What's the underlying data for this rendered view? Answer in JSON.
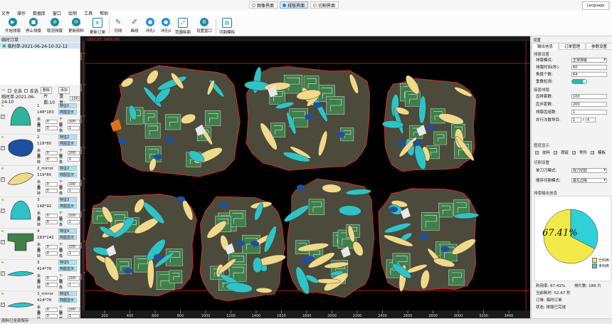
{
  "view_tabs": [
    {
      "label": "图像界面",
      "active": false
    },
    {
      "label": "排版界面",
      "active": true
    },
    {
      "label": "切割界面",
      "active": false
    }
  ],
  "language_label": "Language",
  "menu": [
    "文件",
    "操作",
    "数据库",
    "窗口",
    "绘制",
    "工具",
    "帮助"
  ],
  "toolbar": [
    {
      "label": "开始排版",
      "icon": "play-icon"
    },
    {
      "label": "停止排版",
      "icon": "stop-icon"
    },
    {
      "label": "取消排版",
      "icon": "cancel-icon"
    },
    {
      "label": "更新原料",
      "icon": "refresh-icon"
    },
    {
      "label": "更新订单",
      "icon": "document-icon"
    },
    {
      "label": "切线",
      "icon": "pen-icon"
    },
    {
      "label": "画线",
      "icon": "pencil-icon"
    },
    {
      "label": "冲孔I",
      "icon": "punch-icon"
    },
    {
      "label": "冲孔II",
      "icon": "punch-icon"
    },
    {
      "label": "范围标割",
      "icon": "expand-icon"
    },
    {
      "label": "设置窗口",
      "icon": "gear-icon"
    },
    {
      "label": "切割模拟",
      "icon": "simulate-icon"
    }
  ],
  "left": {
    "header": "临时订单",
    "order_name": "临时单-2021-06-24-10-32-12",
    "select_all": "全选",
    "invert": "反选",
    "delete": "删除",
    "add": "添加",
    "layout_label": "临时单-2021-06-24-10",
    "piece_count_label": "片数:10",
    "repeat_label": "重复:",
    "repeat_value": "100",
    "parts": [
      {
        "name": "1",
        "dim": "148*183",
        "b1": "特征1",
        "b2": "简图显示",
        "qty_label": "余量",
        "qty": "0",
        "cnt_label": "个数",
        "cnt": "100",
        "rot_label": "旋转",
        "rot": "0",
        "mirror_label": "镜像",
        "mirror": "1",
        "shape": "bell",
        "color": "#2fb39a",
        "checked": true
      },
      {
        "name": "2",
        "dim": "119*80",
        "b1": "特征2",
        "b2": "简图显示",
        "qty_label": "余量",
        "qty": "0",
        "cnt_label": "个数",
        "cnt": "100",
        "rot_label": "旋转",
        "rot": "0",
        "mirror_label": "镜像",
        "mirror": "1",
        "shape": "blob",
        "color": "#1f4fa0",
        "checked": true
      },
      {
        "name": "2_mirror",
        "dim": "119*80",
        "b1": "特征2",
        "b2": "简图显示",
        "qty_label": "余量",
        "qty": "0",
        "cnt_label": "个数",
        "cnt": "100",
        "rot_label": "旋转",
        "rot": "0",
        "mirror_label": "镜像",
        "mirror": "1",
        "shape": "leaf",
        "color": "#f0d98a",
        "checked": true
      },
      {
        "name": "3",
        "dim": "148*92",
        "b1": "特征3",
        "b2": "简图显示",
        "qty_label": "余量",
        "qty": "0",
        "cnt_label": "个数",
        "cnt": "100",
        "rot_label": "旋转",
        "rot": "0",
        "mirror_label": "镜像",
        "mirror": "1",
        "shape": "bell",
        "color": "#2fc3c6",
        "checked": true
      },
      {
        "name": "4",
        "dim": "283*142",
        "b1": "特征4",
        "b2": "简图显示",
        "qty_label": "余量",
        "qty": "0",
        "cnt_label": "个数",
        "cnt": "100",
        "rot_label": "旋转",
        "rot": "0",
        "mirror_label": "镜像",
        "mirror": "1",
        "shape": "tee",
        "color": "#3f7f4a",
        "checked": true
      },
      {
        "name": "3",
        "dim": "414*78",
        "b1": "特征5",
        "b2": "简图显示",
        "qty_label": "余量",
        "qty": "0",
        "cnt_label": "个数",
        "cnt": "100",
        "rot_label": "旋转",
        "rot": "0",
        "mirror_label": "镜像",
        "mirror": "1",
        "shape": "sliver",
        "color": "#2fc3c6",
        "checked": true
      },
      {
        "name": "3_mirror",
        "dim": "414*78",
        "b1": "特征5",
        "b2": "简图显示",
        "qty_label": "余量",
        "qty": "0",
        "cnt_label": "个数",
        "cnt": "100",
        "rot_label": "旋转",
        "rot": "0",
        "mirror_label": "镜像",
        "mirror": "1",
        "shape": "sliver",
        "color": "#2fc3c6",
        "checked": true
      }
    ]
  },
  "canvas": {
    "coord_text": "(257.37, 1465.39)",
    "x_ticks": [
      "200",
      "400",
      "600",
      "800",
      "1000",
      "1200",
      "1400",
      "1600",
      "1800",
      "2000",
      "2200",
      "2400",
      "2600",
      "2800",
      "3000",
      "3200",
      "3400"
    ],
    "y_ticks": [
      "1600",
      "1400",
      "1200",
      "1000",
      "800",
      "600",
      "400",
      "200"
    ]
  },
  "right": {
    "header": "设置",
    "tabs": [
      "输出信息",
      "订单管理",
      "参数设置"
    ],
    "nest_group": "排版设置",
    "nest_mode_label": "排版模式:",
    "nest_mode_value": "正常排版",
    "nest_time_label": "排版时间(秒):",
    "nest_time_value": "60",
    "angle_count_label": "角度个数:",
    "angle_count_value": "64",
    "overlap_label": "重叠检测:",
    "offset_group": "接套排版",
    "length_label": "齿排套数:",
    "length_value": "100",
    "width_label": "齿步距数:",
    "width_value": "200",
    "row_label": "排版齿组数:",
    "row_value": "1",
    "parallel_label": "并行次数导目:",
    "parallel_a": "1",
    "parallel_b": "4",
    "display_group": "图层显示",
    "display_items": [
      "皮料",
      "瑕疵",
      "零件",
      "模板"
    ],
    "cut_group": "切割设置",
    "cut_mode_label": "单刀刀模式:",
    "cut_mode_value": "双刀切割",
    "cut_order_label": "顺序切割模式:",
    "cut_order_value": "最左边缘",
    "output_group": "排版输出信息",
    "utilization_text": "67.41%",
    "legend_used": "已利用",
    "legend_unused": "未利用",
    "util_line_label": "利用率: 67.41%",
    "pieces_line_label": "排片数: 189 片",
    "time_line_label": "当前耗时: 52.67 秒",
    "order_line_label": "订单: 临时订单",
    "status_line_label": "状态: 排版已完成"
  },
  "pie": {
    "type": "pie",
    "values": [
      67.41,
      32.59
    ],
    "labels": [
      "已利用",
      "未利用"
    ],
    "colors": [
      "#f2ea4a",
      "#2fd0d8"
    ]
  },
  "status_bar": "原料已全部保存",
  "colors": {
    "accent": "#1a8a9a",
    "cut_line": "#e02020",
    "piece_green": "#3f7f4a",
    "piece_cyan": "#2fc3c6",
    "piece_yellow": "#f0d98a",
    "piece_blue": "#1f4fa0",
    "piece_brown": "#6b4a2a"
  }
}
